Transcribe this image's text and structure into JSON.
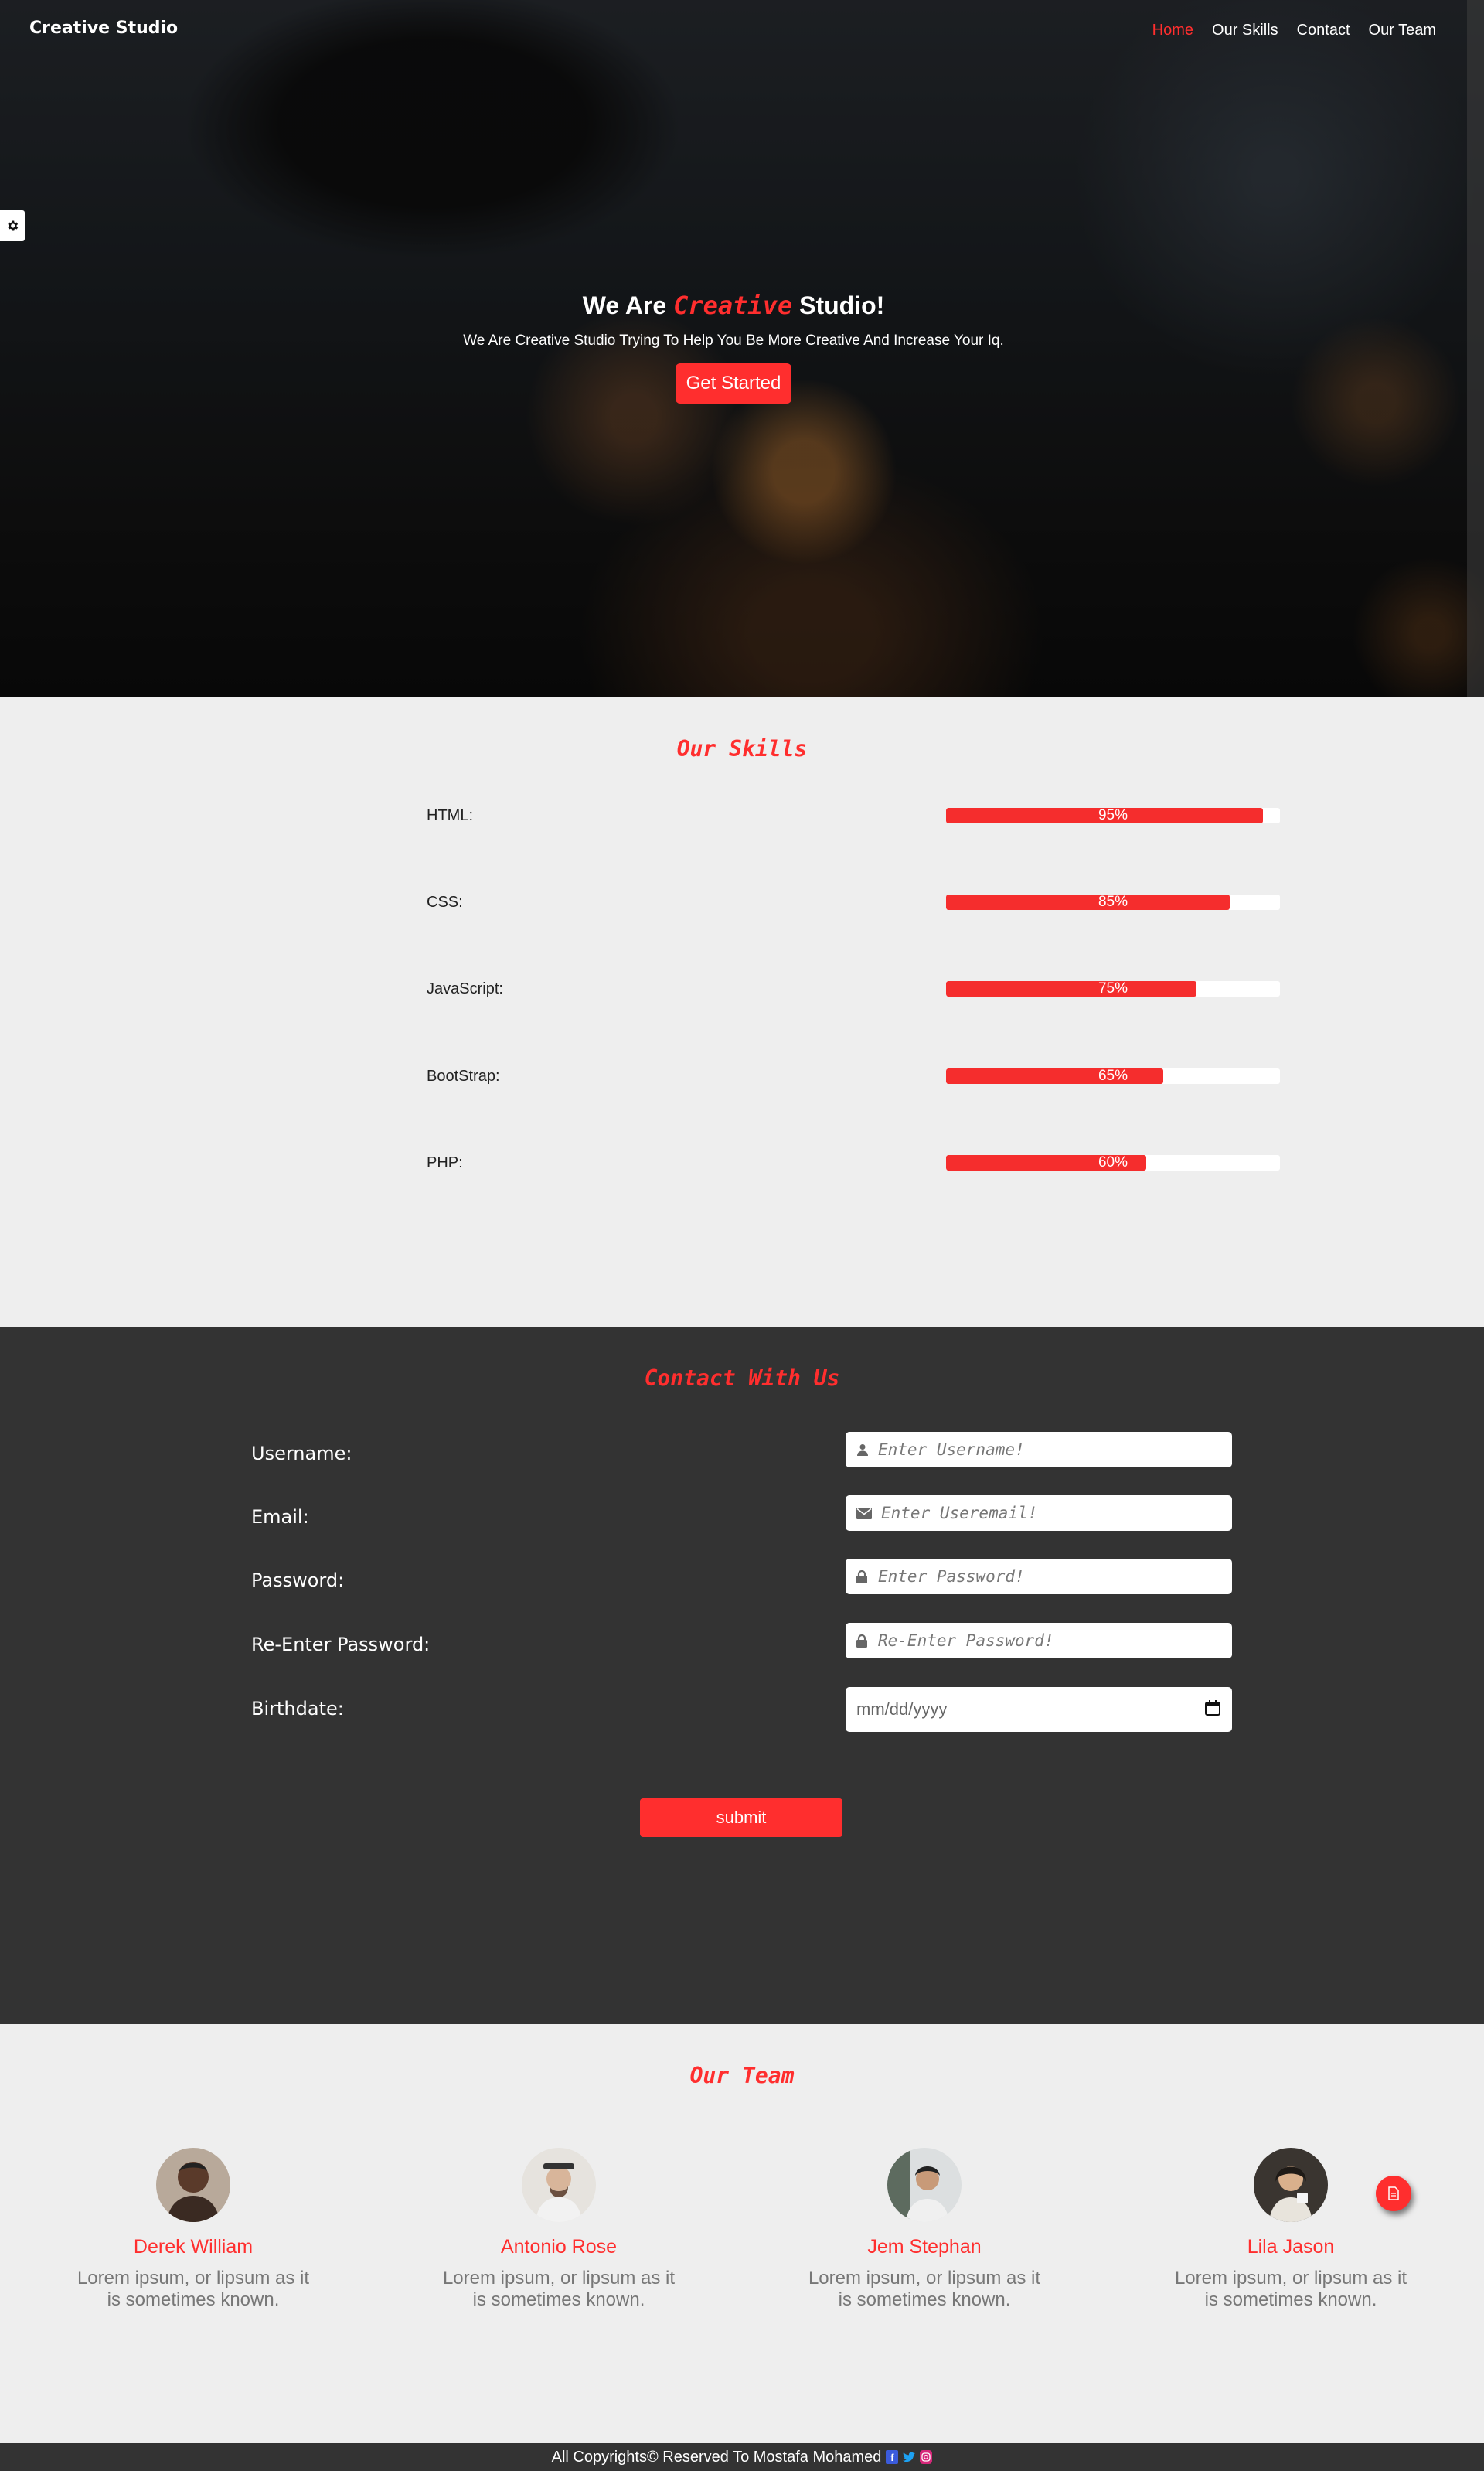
{
  "header": {
    "brand": "Creative Studio",
    "nav": [
      {
        "label": "Home",
        "active": true
      },
      {
        "label": "Our Skills",
        "active": false
      },
      {
        "label": "Contact",
        "active": false
      },
      {
        "label": "Our Team",
        "active": false
      }
    ],
    "settings_icon": "gear-icon"
  },
  "hero": {
    "title_prefix": "We Are",
    "title_accent": "Creative",
    "title_suffix": "Studio!",
    "subtitle": "We Are Creative Studio Trying To Help You Be More Creative And Increase Your Iq.",
    "cta_label": "Get Started"
  },
  "skills": {
    "title": "Our Skills",
    "items": [
      {
        "label": "HTML:",
        "percent": 95,
        "percent_text": "95%"
      },
      {
        "label": "CSS:",
        "percent": 85,
        "percent_text": "85%"
      },
      {
        "label": "JavaScript:",
        "percent": 75,
        "percent_text": "75%"
      },
      {
        "label": "BootStrap:",
        "percent": 65,
        "percent_text": "65%"
      },
      {
        "label": "PHP:",
        "percent": 60,
        "percent_text": "60%"
      }
    ]
  },
  "contact": {
    "title": "Contact With Us",
    "fields": [
      {
        "label": "Username:",
        "placeholder": "Enter Username!",
        "icon": "user-icon"
      },
      {
        "label": "Email:",
        "placeholder": "Enter Useremail!",
        "icon": "envelope-icon"
      },
      {
        "label": "Password:",
        "placeholder": "Enter Password!",
        "icon": "lock-icon"
      },
      {
        "label": "Re-Enter Password:",
        "placeholder": "Re-Enter Password!",
        "icon": "lock-icon"
      }
    ],
    "birthdate": {
      "label": "Birthdate:",
      "placeholder": "mm/dd/yyyy",
      "icon": "calendar-icon"
    },
    "submit_label": "submit"
  },
  "team": {
    "title": "Our Team",
    "members": [
      {
        "name": "Derek William",
        "desc": "Lorem ipsum, or lipsum as it is sometimes known."
      },
      {
        "name": "Antonio Rose",
        "desc": "Lorem ipsum, or lipsum as it is sometimes known."
      },
      {
        "name": "Jem Stephan",
        "desc": "Lorem ipsum, or lipsum as it is sometimes known."
      },
      {
        "name": "Lila Jason",
        "desc": "Lorem ipsum, or lipsum as it is sometimes known."
      }
    ],
    "fab_icon": "document-icon"
  },
  "footer": {
    "text": "All Copyrights© Reserved To Mostafa Mohamed",
    "social_icons": [
      "facebook-icon",
      "twitter-icon",
      "instagram-icon"
    ]
  },
  "colors": {
    "accent": "#ff2e2e",
    "dark_section": "#333333",
    "light_section": "#eeeeee"
  }
}
